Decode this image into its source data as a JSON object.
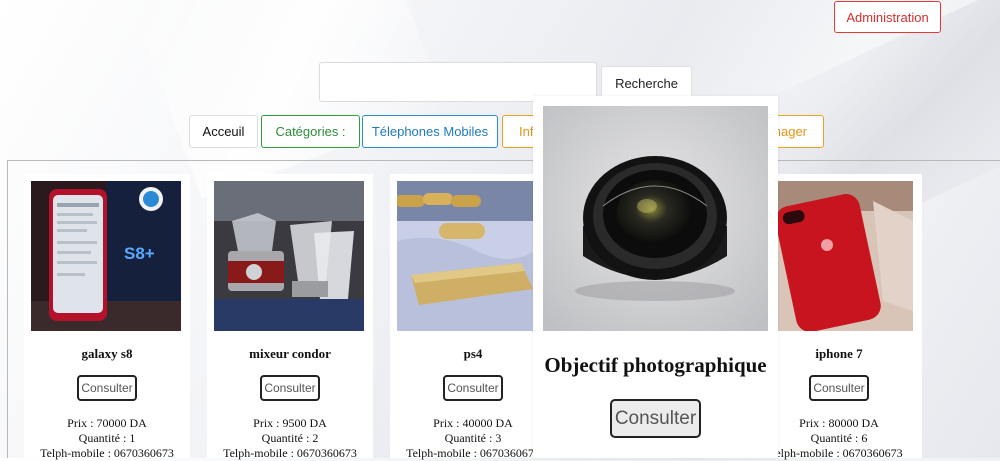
{
  "header": {
    "admin_label": "Administration"
  },
  "search": {
    "placeholder": "",
    "value": "",
    "button_label": "Recherche"
  },
  "nav": {
    "home": "Acceuil",
    "categories": "Catégories :",
    "phones": "Télephones Mobiles",
    "info_partial": "Inf",
    "menager_partial": "nager"
  },
  "products": [
    {
      "name": "galaxy s8",
      "consult_label": "Consulter",
      "price": "Prix : 70000 DA",
      "quantity": "Quantité : 1",
      "phone": "Telph-mobile : 0670360673",
      "icon": "phone-box-photo"
    },
    {
      "name": "mixeur condor",
      "consult_label": "Consulter",
      "price": "Prix : 9500 DA",
      "quantity": "Quantité : 2",
      "phone": "Telph-mobile : 0670360673",
      "icon": "blender-photo"
    },
    {
      "name": "ps4",
      "consult_label": "Consulter",
      "price": "Prix : 40000 DA",
      "quantity": "Quantité : 3",
      "phone": "Telph-mobile : 0670360673",
      "icon": "console-photo"
    },
    {
      "name": "iphone 7",
      "consult_label": "Consulter",
      "price": "Prix : 80000 DA",
      "quantity": "Quantité : 6",
      "phone": "elph-mobile : 0670360673",
      "icon": "red-phone-photo"
    }
  ],
  "popup": {
    "name": "Objectif photographique",
    "consult_label": "Consulter",
    "icon": "camera-lens-photo"
  },
  "colors": {
    "admin": "#e53935",
    "categories": "#2e9e3f",
    "phones": "#2a8bd6",
    "warning": "#f0a020"
  }
}
